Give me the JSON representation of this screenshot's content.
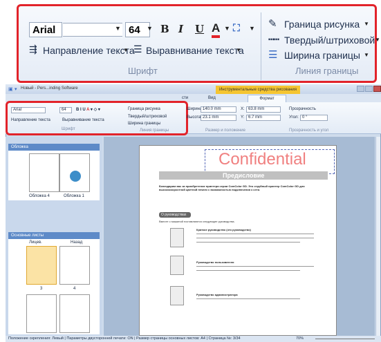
{
  "zoom": {
    "font_name": "Arial",
    "font_size": "64",
    "bold": "B",
    "italic": "I",
    "underline": "U",
    "font_color_letter": "A",
    "text_direction": "Направление текста",
    "text_align": "Выравнивание текста",
    "group_font": "Шрифт",
    "border_shape": "Граница рисунка",
    "line_style": "Твердый/штриховой",
    "line_width": "Ширина границы",
    "group_line": "Линия границы"
  },
  "window": {
    "title": "Новый - Pers...inding Software",
    "tools_tab": "Инструментальные средства рисования",
    "tab_partial": "сти",
    "tab_view": "Вид",
    "tab_format": "Формат"
  },
  "ribbon": {
    "font_name": "Arial",
    "font_size": "64",
    "text_direction": "Направление текста",
    "text_align": "Выравнивание текста",
    "group_font": "Шрифт",
    "border_shape": "Граница рисунка",
    "line_style": "Твердый/штриховой",
    "line_width": "Ширина границы",
    "group_line": "Линия границы",
    "width_label": "Ширина:",
    "width_value": "140.0 mm",
    "height_label": "Высота:",
    "height_value": "23.1 mm",
    "x_label": "X:",
    "x_value": "63.8 mm",
    "y_label": "Y:",
    "y_value": "6.7 mm",
    "group_size": "Размер и положение",
    "transparency": "Прозрачность",
    "angle_label": "Угол:",
    "angle_value": "0 °",
    "group_transp": "Прозрачность и угол"
  },
  "sidebar": {
    "covers_header": "Обложка",
    "cover4": "Обложка 4",
    "cover1": "Обложка 1",
    "main_header": "Основные листы",
    "col_front": "Лицев.",
    "col_back": "Назад",
    "page3": "3",
    "page4": "4"
  },
  "document": {
    "confidential": "Confidential",
    "heading": "Предисловие",
    "intro": "Благодарим вас за приобретение принтера серии ComColor GD. Это струйный принтер ComColor GD для высокоскоростной цветной печати с возможностью подключения к сети.",
    "section": "О руководствах",
    "section_sub": "Вместе с машиной поставляются следующие руководства.",
    "item1_title": "Краткое руководство (это руководство)",
    "item2_title": "Руководство пользователя",
    "item3_title": "Руководство администратора"
  },
  "status": {
    "text": "Положение скрепления: Левый  |  Параметры двусторонней печати: ON  |  Размер страницы основных листов: A4  |  Страница №: 3/34",
    "zoom": "70%"
  }
}
